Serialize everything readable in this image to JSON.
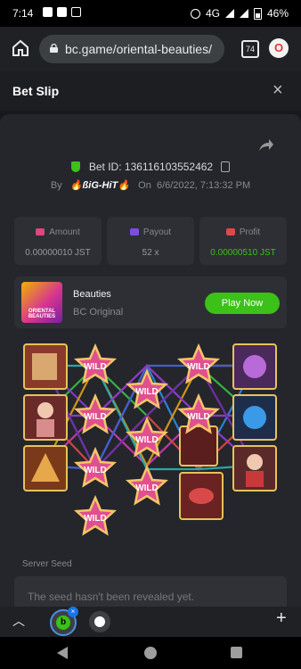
{
  "status": {
    "time": "7:14",
    "network": "4G",
    "battery": "46%"
  },
  "browser": {
    "url": "bc.game/oriental-beauties/",
    "tab_count": "74",
    "extension_icon": "opera-icon"
  },
  "header": {
    "title": "Bet Slip",
    "close": "×"
  },
  "bet": {
    "id_text": "Bet ID: 136116103552462",
    "by_label": "By",
    "user": "🔥ßiG-HiT🔥",
    "on_label": "On",
    "datetime": "6/6/2022, 7:13:32 PM"
  },
  "stats": {
    "amount_label": "Amount",
    "amount_value": "0.00000010 JST",
    "payout_label": "Payout",
    "payout_value": "52 x",
    "profit_label": "Profit",
    "profit_value": "0.00000510 JST"
  },
  "game": {
    "name": "Beauties",
    "provider": "BC Original",
    "thumb_text": "ORIENTAL BEAUTIES",
    "play_label": "Play Now"
  },
  "board": {
    "wild_label": "WILD",
    "left_symbols": [
      "scroll-icon",
      "beauty-icon",
      "fan-icon"
    ],
    "right_symbols": [
      "lotus-icon",
      "blue-flower-icon",
      "woman-icon"
    ]
  },
  "seed": {
    "label": "Server Seed",
    "text": "The seed hasn't been revealed yet."
  },
  "colors": {
    "accent": "#3bc117",
    "background": "#17181b",
    "card": "#24262b",
    "panel": "#2d2f35"
  }
}
